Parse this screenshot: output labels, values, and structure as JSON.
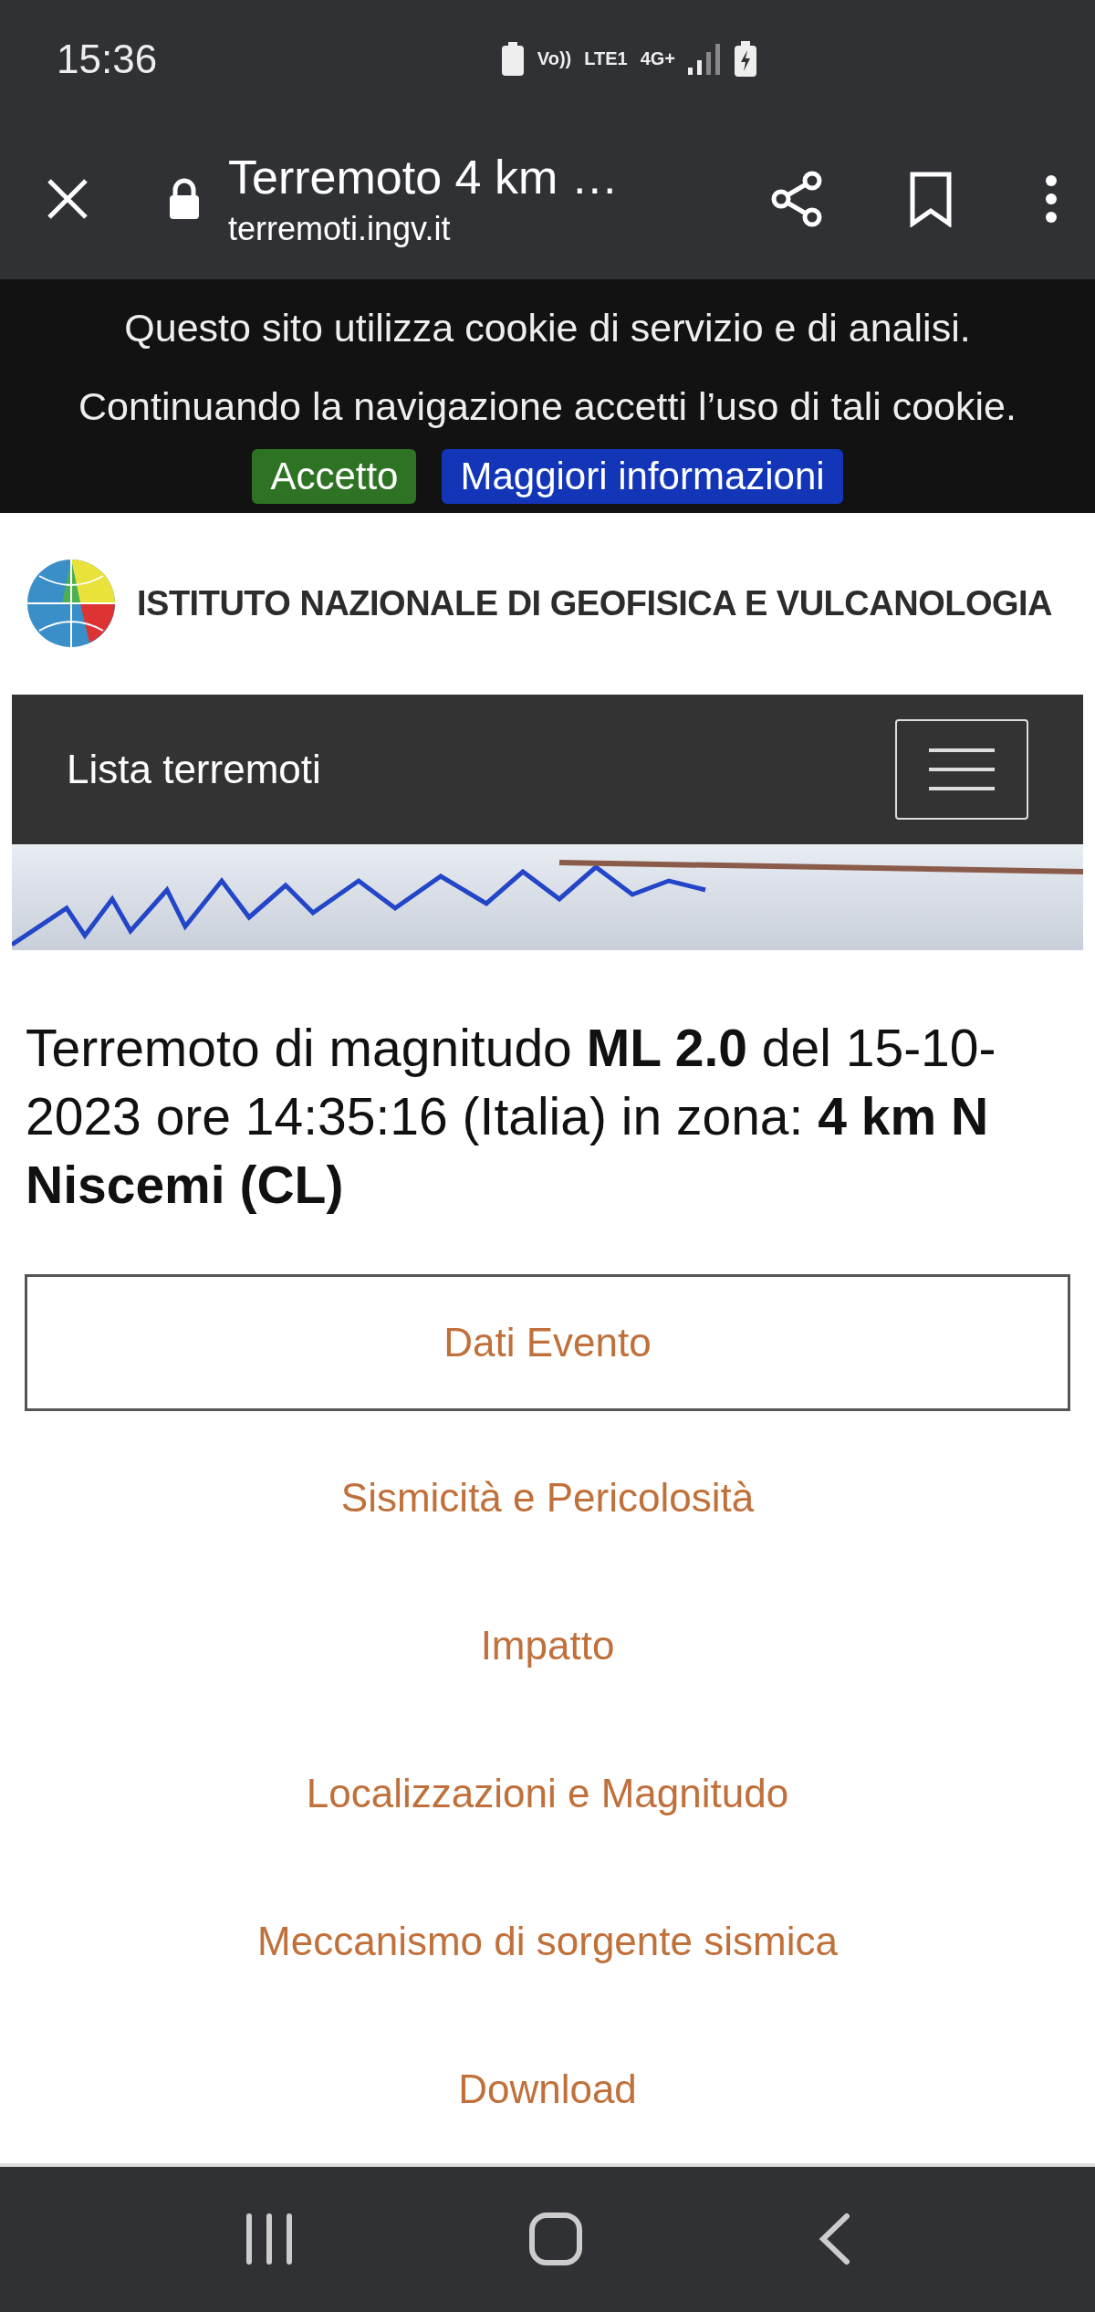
{
  "status_bar": {
    "time": "15:36",
    "indicators": [
      "Vo))",
      "LTE1",
      "4G+"
    ]
  },
  "browser": {
    "title": "Terremoto 4 km …",
    "url": "terremoti.ingv.it"
  },
  "cookie_banner": {
    "lines": [
      "Questo sito utilizza cookie di servizio e di analisi.",
      "Continuando la navigazione accetti l’uso di tali cookie."
    ],
    "buttons": [
      {
        "label": "Accetto",
        "kind": "accept"
      },
      {
        "label": "Maggiori informazioni",
        "kind": "info"
      }
    ]
  },
  "header": {
    "institute": "ISTITUTO NAZIONALE DI GEOFISICA E VULCANOLOGIA"
  },
  "navbar": {
    "title": "Lista terremoti"
  },
  "event": {
    "heading": "Terremoto di magnitudo **ML 2.0** del 15-10-2023 ore 14:35:16 (Italia) in zona: **4 km N Niscemi (CL)**"
  },
  "tabs": [
    {
      "label": "Dati Evento",
      "selected": true
    },
    {
      "label": "Sismicità e Pericolosità",
      "selected": false
    },
    {
      "label": "Impatto",
      "selected": false
    },
    {
      "label": "Localizzazioni e Magnitudo",
      "selected": false
    },
    {
      "label": "Meccanismo di sorgente sismica",
      "selected": false
    },
    {
      "label": "Download",
      "selected": false
    }
  ]
}
